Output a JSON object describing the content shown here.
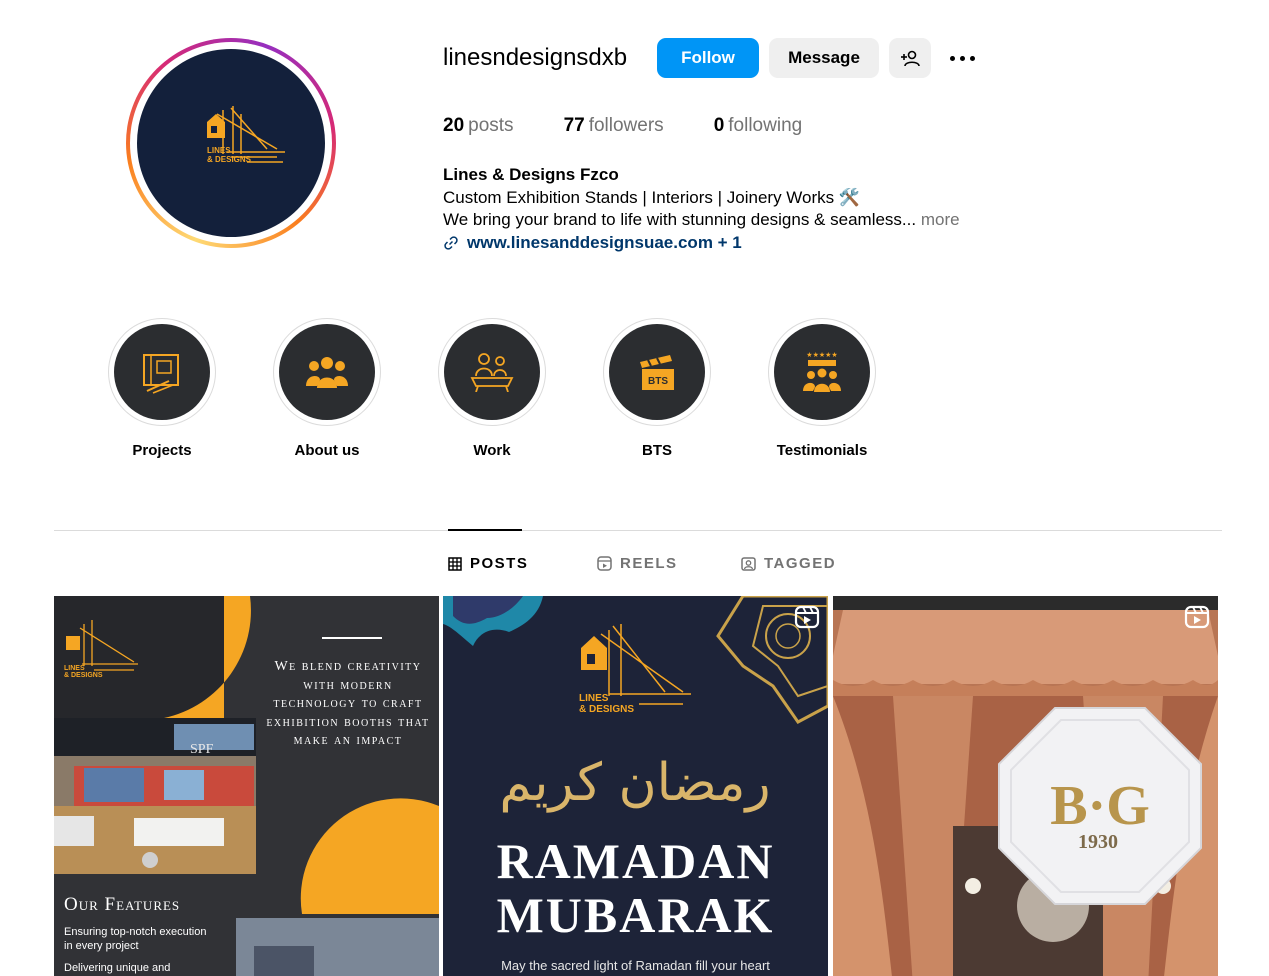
{
  "profile": {
    "username": "linesndesignsdxb",
    "logo_text_1": "LINES",
    "logo_text_2": "& DESIGNS",
    "buttons": {
      "follow": "Follow",
      "message": "Message"
    },
    "stats": {
      "posts_count": "20",
      "posts_label": "posts",
      "followers_count": "77",
      "followers_label": "followers",
      "following_count": "0",
      "following_label": "following"
    },
    "bio": {
      "full_name": "Lines & Designs Fzco",
      "line1": "Custom Exhibition Stands | Interiors | Joinery Works 🛠️",
      "line2": "We bring your brand to life with stunning designs & seamless... ",
      "more": "more",
      "link": "www.linesanddesignsuae.com + 1"
    }
  },
  "highlights": [
    {
      "label": "Projects",
      "icon": "blueprint-icon"
    },
    {
      "label": "About us",
      "icon": "team-icon"
    },
    {
      "label": "Work",
      "icon": "meeting-icon"
    },
    {
      "label": "BTS",
      "icon": "clapperboard-icon"
    },
    {
      "label": "Testimonials",
      "icon": "rating-people-icon"
    }
  ],
  "tabs": [
    {
      "label": "POSTS",
      "icon": "grid-icon",
      "active": true
    },
    {
      "label": "REELS",
      "icon": "reels-icon",
      "active": false
    },
    {
      "label": "TAGGED",
      "icon": "tagged-icon",
      "active": false
    }
  ],
  "posts": [
    {
      "type": "image",
      "tagline": "We blend creativity with modern technology to craft exhibition booths that make an impact",
      "booth_brand": "SPF",
      "features_title": "Our Features",
      "feature1": "Ensuring top-notch execution in every project",
      "feature2": "Delivering unique and"
    },
    {
      "type": "reel",
      "arabic": "رمضان كريم",
      "title_1": "RAMADAN",
      "title_2": "MUBARAK",
      "caption": "May the sacred light of Ramadan fill your heart"
    },
    {
      "type": "reel",
      "sign_text": "B·G",
      "sign_year": "1930"
    }
  ],
  "colors": {
    "accent_blue": "#0095f6",
    "brand_orange": "#f5a623",
    "link_blue": "#00376b",
    "muted_text": "#737373"
  }
}
